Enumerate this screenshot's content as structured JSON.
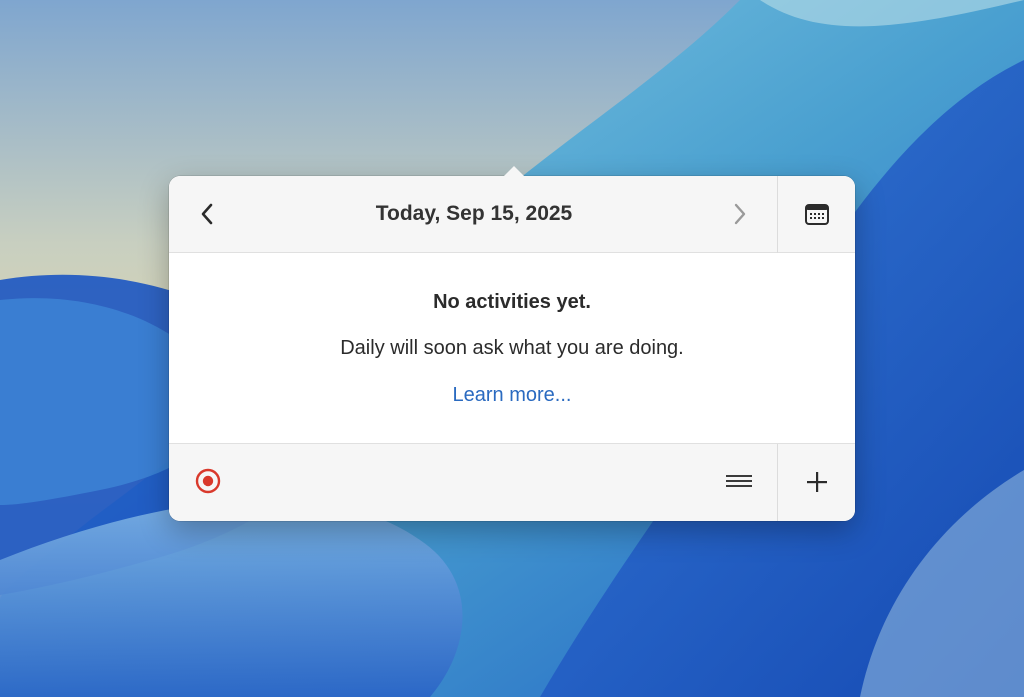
{
  "popover": {
    "date_title": "Today, Sep 15, 2025",
    "empty_title": "No activities yet.",
    "empty_text": "Daily will soon ask what you are doing.",
    "learn_more": "Learn more..."
  },
  "icons": {
    "prev": "chevron-left-icon",
    "next": "chevron-right-icon",
    "calendar": "calendar-icon",
    "record": "record-icon",
    "list": "list-icon",
    "add": "plus-icon"
  },
  "colors": {
    "link": "#2a6ac0",
    "record": "#d9392c",
    "popover_bg": "#ffffff",
    "bar_bg": "#f6f6f6",
    "text": "#2b2b2b"
  }
}
